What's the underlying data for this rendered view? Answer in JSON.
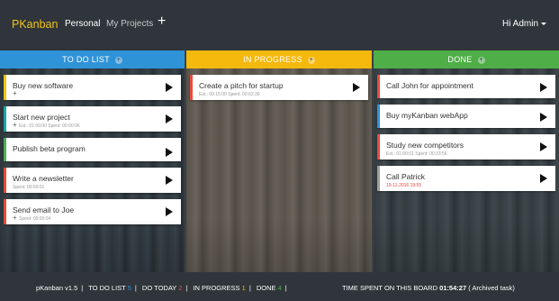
{
  "navbar": {
    "brand": "PKanban",
    "links": [
      {
        "label": "Personal"
      },
      {
        "label": "My Projects"
      }
    ],
    "add_label": "+",
    "user_label": "Hi Admin"
  },
  "columns": [
    {
      "title": "TO DO LIST",
      "color": "#2f93d8",
      "cards": [
        {
          "title": "Buy new software",
          "accent": "#f1c40f",
          "meta": "",
          "has_plus": true
        },
        {
          "title": "Start new project",
          "accent": "#1aa6a6",
          "meta": "Est.: 01:00:00 Spent: 00:00:06",
          "has_plus": true
        },
        {
          "title": "Publish beta program",
          "accent": "#4caf50",
          "meta": "",
          "has_plus": false
        },
        {
          "title": "Write a newsletter",
          "accent": "#e74c3c",
          "meta": "Spent: 00:00:01",
          "has_plus": false
        },
        {
          "title": "Send email to Joe",
          "accent": "#e74c3c",
          "meta": "Spent: 00:00:04",
          "has_plus": true
        }
      ]
    },
    {
      "title": "IN PROGRESS",
      "color": "#f5b80c",
      "cards": [
        {
          "title": "Create a pitch for startup",
          "accent": "#e74c3c",
          "meta": "Est.: 00:15:00 Spent: 00:02:30",
          "has_plus": false
        }
      ]
    },
    {
      "title": "DONE",
      "color": "#4fae48",
      "cards": [
        {
          "title": "Call John for appointment",
          "accent": "#e74c3c",
          "meta": "",
          "has_plus": false
        },
        {
          "title": "Buy myKanban webApp",
          "accent": "#2f93d8",
          "meta": "",
          "has_plus": false
        },
        {
          "title": "Study new competitors",
          "accent": "#e74c3c",
          "meta": "Est.: 01:00:01 Spent: 00:33:56",
          "has_plus": false
        },
        {
          "title": "Call Patrick",
          "accent": "#9e9e9e",
          "meta": "19-11-2016 19:55",
          "meta_red": true,
          "has_plus": false
        }
      ]
    }
  ],
  "footer": {
    "version": "pKanban v1.5",
    "todo_list_label": "TO DO LIST",
    "todo_list_count": "5",
    "todo_today_label": "DO TODAY",
    "todo_today_count": "2",
    "in_progress_label": "IN PROGRESS",
    "in_progress_count": "1",
    "done_label": "DONE",
    "done_count": "4",
    "time_label": "TIME SPENT ON THIS BOARD",
    "time_value": "01:54:27",
    "archived_label": "( Archived task)",
    "colors": {
      "todo": "#2f93d8",
      "today": "#e74c3c",
      "progress": "#f5b80c",
      "done": "#4fae48"
    }
  }
}
